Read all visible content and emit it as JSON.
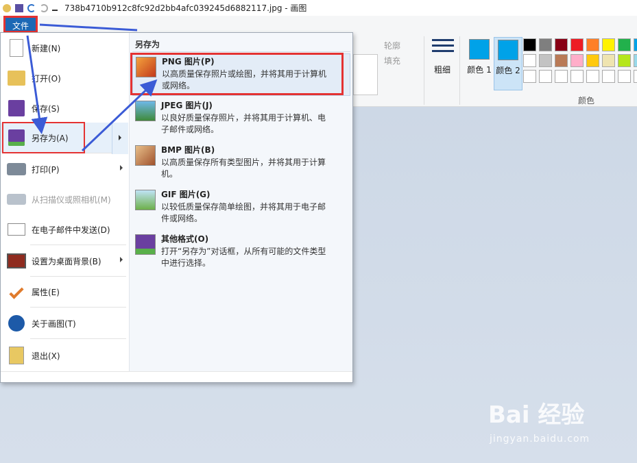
{
  "window": {
    "title": "738b4710b912c8fc92d2bb4afc039245d6882117.jpg - 画图"
  },
  "file_menu_button": "文件",
  "ribbon": {
    "outline_label": "轮廓",
    "fill_label": "填充",
    "size_label": "粗细",
    "color1_label": "颜色 1",
    "color2_label": "颜色 2",
    "colors_group_label": "颜色",
    "palette": [
      "#000000",
      "#7f7f7f",
      "#880015",
      "#ed1c24",
      "#ff7f27",
      "#fff200",
      "#22b14c",
      "#00a2e8",
      "#ffffff",
      "#c3c3c3",
      "#b97a57",
      "#ffaec9",
      "#ffc90e",
      "#efe4b0",
      "#b5e61d",
      "#99d9ea",
      "#ffffff",
      "#ffffff",
      "#ffffff",
      "#ffffff",
      "#ffffff",
      "#ffffff",
      "#ffffff",
      "#ffffff"
    ],
    "color1": "#00a2e8",
    "color2": "#00a2e8"
  },
  "menu_items": [
    {
      "label": "新建(N)",
      "icon": "new-file-icon",
      "disabled": false,
      "has_submenu": false
    },
    {
      "label": "打开(O)",
      "icon": "open-folder-icon",
      "disabled": false,
      "has_submenu": false
    },
    {
      "label": "保存(S)",
      "icon": "save-icon",
      "disabled": false,
      "has_submenu": false
    },
    {
      "label": "另存为(A)",
      "icon": "save-as-icon",
      "disabled": false,
      "has_submenu": true
    },
    {
      "label": "打印(P)",
      "icon": "printer-icon",
      "disabled": false,
      "has_submenu": true
    },
    {
      "label": "从扫描仪或照相机(M)",
      "icon": "scanner-icon",
      "disabled": true,
      "has_submenu": false
    },
    {
      "label": "在电子邮件中发送(D)",
      "icon": "email-icon",
      "disabled": false,
      "has_submenu": false
    },
    {
      "label": "设置为桌面背景(B)",
      "icon": "desktop-background-icon",
      "disabled": false,
      "has_submenu": true
    },
    {
      "label": "属性(E)",
      "icon": "checkmark-icon",
      "disabled": false,
      "has_submenu": false
    },
    {
      "label": "关于画图(T)",
      "icon": "info-icon",
      "disabled": false,
      "has_submenu": false
    },
    {
      "label": "退出(X)",
      "icon": "exit-icon",
      "disabled": false,
      "has_submenu": false
    }
  ],
  "submenu": {
    "heading": "另存为",
    "items": [
      {
        "title": "PNG 图片(P)",
        "desc": "以高质量保存照片或绘图，并将其用于计算机或网络。",
        "icon": "png-image-icon"
      },
      {
        "title": "JPEG 图片(J)",
        "desc": "以良好质量保存照片，并将其用于计算机、电子邮件或网络。",
        "icon": "jpeg-image-icon"
      },
      {
        "title": "BMP 图片(B)",
        "desc": "以高质量保存所有类型图片，并将其用于计算机。",
        "icon": "bmp-image-icon"
      },
      {
        "title": "GIF 图片(G)",
        "desc": "以较低质量保存简单绘图，并将其用于电子邮件或网络。",
        "icon": "gif-image-icon"
      },
      {
        "title": "其他格式(O)",
        "desc": "打开“另存为”对话框，从所有可能的文件类型中进行选择。",
        "icon": "other-formats-icon"
      }
    ]
  },
  "watermark": {
    "brand": "Bai 经验",
    "url": "jingyan.baidu.com"
  }
}
